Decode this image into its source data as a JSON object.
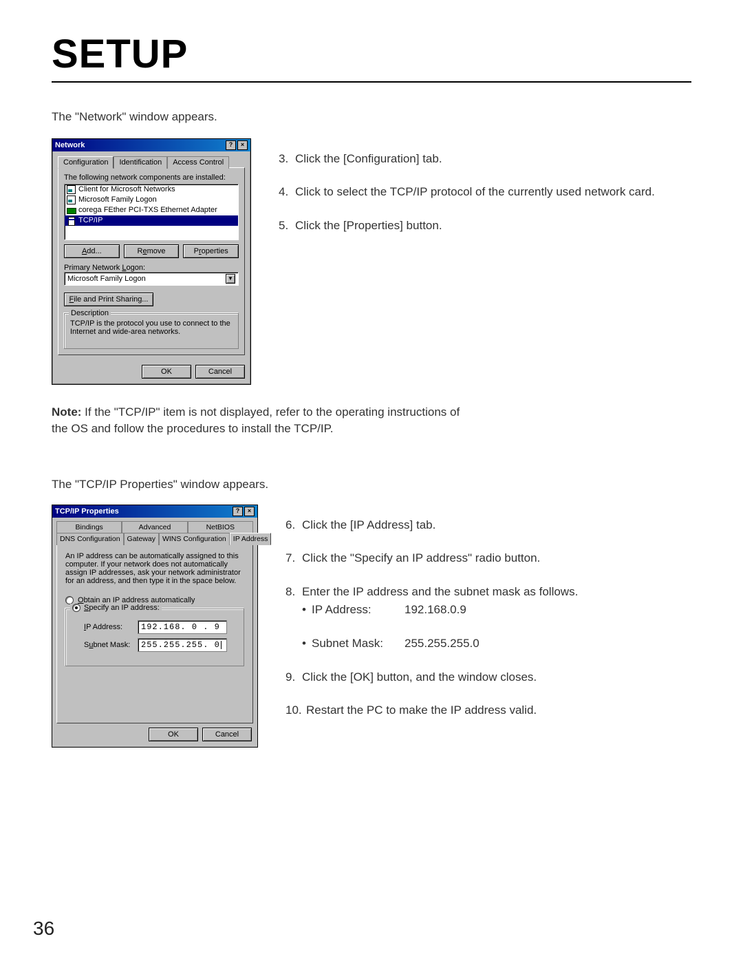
{
  "page_title": "SETUP",
  "page_number": "36",
  "intro_text_1": "The \"Network\" window appears.",
  "note_label": "Note:",
  "note_text": " If the \"TCP/IP\" item is not displayed, refer to the operating instructions of the OS and follow the procedures to install the TCP/IP.",
  "intro_text_2": "The \"TCP/IP Properties\" window appears.",
  "steps_right_1": [
    {
      "n": "3.",
      "t": "Click the [Configuration] tab."
    },
    {
      "n": "4.",
      "t": "Click to select the TCP/IP protocol of the currently used network card."
    },
    {
      "n": "5.",
      "t": "Click the [Properties] button."
    }
  ],
  "steps_right_2": [
    {
      "n": "6.",
      "t": "Click the [IP Address] tab."
    },
    {
      "n": "7.",
      "t": "Click the \"Specify an IP address\" radio button."
    }
  ],
  "step8_n": "8.",
  "step8_t": "Enter the IP address and the subnet mask as follows.",
  "step8_ip_label": "IP Address:",
  "step8_ip_value": "192.168.0.9",
  "step8_mask_label": "Subnet Mask:",
  "step8_mask_value": "255.255.255.0",
  "steps_right_3": [
    {
      "n": "9.",
      "t": "Click the [OK] button, and the window closes."
    },
    {
      "n": "10.",
      "t": "Restart the PC to make the IP address valid."
    }
  ],
  "dlg1": {
    "title": "Network",
    "tabs": {
      "configuration": "Configuration",
      "identification": "Identification",
      "access": "Access Control"
    },
    "installed_label": "The following network components are installed:",
    "items": {
      "client": "Client for Microsoft Networks",
      "logon": "Microsoft Family Logon",
      "adapter": "corega FEther PCI-TXS Ethernet Adapter",
      "tcpip": "TCP/IP"
    },
    "btn_add": "Add...",
    "btn_remove": "Remove",
    "btn_properties": "Properties",
    "primary_logon_label": "Primary Network Logon:",
    "primary_logon_value": "Microsoft Family Logon",
    "btn_fileshare": "File and Print Sharing...",
    "desc_label": "Description",
    "desc_text": "TCP/IP is the protocol you use to connect to the Internet and wide-area networks.",
    "ok": "OK",
    "cancel": "Cancel"
  },
  "dlg2": {
    "title": "TCP/IP Properties",
    "tabs_row1": {
      "bindings": "Bindings",
      "advanced": "Advanced",
      "netbios": "NetBIOS"
    },
    "tabs_row2": {
      "dns": "DNS Configuration",
      "gateway": "Gateway",
      "wins": "WINS Configuration",
      "ip": "IP Address"
    },
    "blurb": "An IP address can be automatically assigned to this computer. If your network does not automatically assign IP addresses, ask your network administrator for an address, and then type it in the space below.",
    "radio_obtain_prefix": "O",
    "radio_obtain_rest": "btain an IP address automatically",
    "radio_specify_prefix": "S",
    "radio_specify_rest": "pecify an IP address:",
    "ip_label_prefix": "I",
    "ip_label_rest": "P Address:",
    "subnet_label_prefix": "u",
    "subnet_label_pre": "S",
    "subnet_label_rest": "bnet Mask:",
    "ip_value": "192.168. 0 . 9",
    "mask_value": "255.255.255. 0",
    "ok": "OK",
    "cancel": "Cancel"
  }
}
